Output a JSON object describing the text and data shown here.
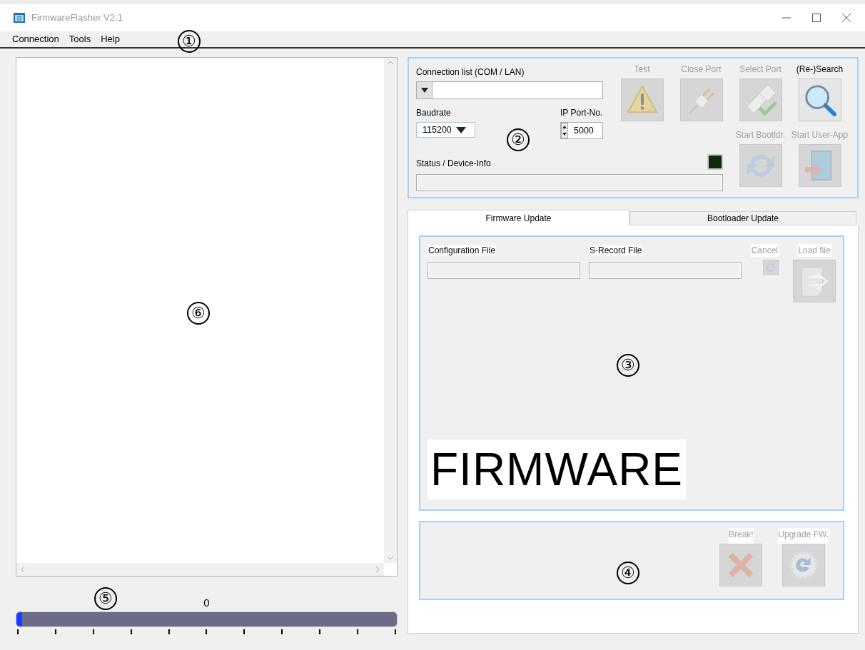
{
  "window": {
    "title": "FirmwareFlasher V2.1"
  },
  "menu": [
    {
      "label": "Connection"
    },
    {
      "label": "Tools"
    },
    {
      "label": "Help"
    }
  ],
  "progress": {
    "reading": "0",
    "level": 0.015
  },
  "connection": {
    "list_label": "Connection list (COM / LAN)",
    "baud_label": "Baudrate",
    "baud_value": "115200",
    "port_label": "IP Port-No.",
    "port_value": "5000",
    "status_label": "Status / Device-Info",
    "led_on": false
  },
  "actions": [
    {
      "label": "Test",
      "disabled": true
    },
    {
      "label": "Close Port",
      "disabled": true
    },
    {
      "label": "Select Port",
      "disabled": true
    },
    {
      "label": "(Re-)Search",
      "disabled": false
    },
    {
      "label": "Start Bootldr.",
      "disabled": true
    },
    {
      "label": "Start User-App",
      "disabled": true
    }
  ],
  "tabs": [
    {
      "label": "Firmware Update",
      "selected": true
    },
    {
      "label": "Bootloader Update",
      "selected": false
    }
  ],
  "firmware": {
    "config_label": "Configuration File",
    "srecord_label": "S-Record File",
    "cancel": {
      "label": "Cancel",
      "disabled": true
    },
    "load": {
      "label": "Load file",
      "disabled": true
    },
    "banner": "FIRMWARE"
  },
  "flash_actions": [
    {
      "label": "Break!",
      "disabled": true
    },
    {
      "label": "Upgrade FW.",
      "disabled": true
    }
  ],
  "callouts": [
    {
      "label": "①"
    },
    {
      "label": "②"
    },
    {
      "label": "③"
    },
    {
      "label": "④"
    },
    {
      "label": "⑤"
    },
    {
      "label": "⑥"
    }
  ]
}
